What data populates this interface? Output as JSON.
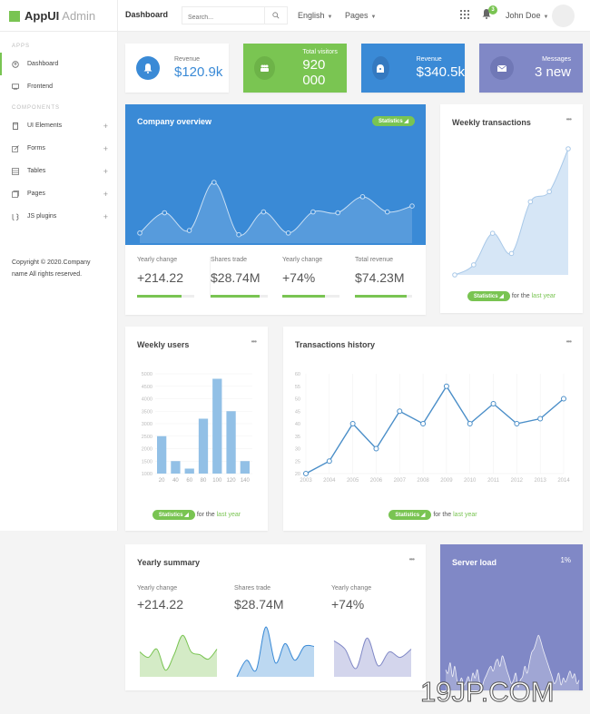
{
  "brand": {
    "name_bold": "AppUI",
    "name_light": "Admin"
  },
  "topbar": {
    "title": "Dashboard",
    "search_placeholder": "Search...",
    "language": "English",
    "pages": "Pages",
    "notifications_count": "3",
    "user_name": "John Doe"
  },
  "sidebar": {
    "section_apps": "APPS",
    "section_components": "COMPONENTS",
    "apps": [
      {
        "label": "Dashboard",
        "icon": "dashboard-icon",
        "active": true
      },
      {
        "label": "Frontend",
        "icon": "monitor-icon"
      }
    ],
    "components": [
      {
        "label": "UI Elements",
        "icon": "mobile-icon"
      },
      {
        "label": "Forms",
        "icon": "edit-icon"
      },
      {
        "label": "Tables",
        "icon": "table-icon"
      },
      {
        "label": "Pages",
        "icon": "copy-icon"
      },
      {
        "label": "JS plugins",
        "icon": "plugin-icon"
      }
    ],
    "copyright_line1": "Copyright © 2020.Company",
    "copyright_line2": "name All rights reserved."
  },
  "stats": [
    {
      "label": "Revenue",
      "value": "$120.9k",
      "icon": "bell-icon",
      "bg": "#ffffff",
      "accent": "#3a8ad6"
    },
    {
      "label": "Total visitors",
      "value": "920 000",
      "icon": "users-icon",
      "bg": "#7ac552",
      "accent": "#6db348"
    },
    {
      "label": "Revenue",
      "value": "$340.5k",
      "icon": "piggy-bank-icon",
      "bg": "#3a8ad6",
      "accent": "#3479c0"
    },
    {
      "label": "Messages",
      "value": "3 new",
      "icon": "envelope-icon",
      "bg": "#8088c6",
      "accent": "#7078b6"
    }
  ],
  "company_overview": {
    "title": "Company overview",
    "badge": "Statistics",
    "kpis": [
      {
        "label": "Yearly change",
        "value": "+214.22",
        "progress": 0.78
      },
      {
        "label": "Shares trade",
        "value": "$28.74M",
        "progress": 0.85
      },
      {
        "label": "Yearly change",
        "value": "+74%",
        "progress": 0.75
      },
      {
        "label": "Total revenue",
        "value": "$74.23M",
        "progress": 0.9
      }
    ]
  },
  "weekly_transactions": {
    "title": "Weekly transactions",
    "badge": "Statistics",
    "footer_text": "for the",
    "footer_link": "last year"
  },
  "weekly_users": {
    "title": "Weekly users",
    "badge": "Statistics",
    "footer_text": "for the",
    "footer_link": "last year"
  },
  "transactions_history": {
    "title": "Transactions history",
    "badge": "Statistics",
    "footer_text": "for the",
    "footer_link": "last year"
  },
  "yearly_summary": {
    "title": "Yearly summary",
    "items": [
      {
        "label": "Yearly change",
        "value": "+214.22",
        "color": "#79c452",
        "fill": "#d4ebc6"
      },
      {
        "label": "Shares trade",
        "value": "$28.74M",
        "color": "#3a8ad6",
        "fill": "#bcd8f1"
      },
      {
        "label": "Yearly change",
        "value": "+74%",
        "color": "#8088c6",
        "fill": "#d3d5ec"
      }
    ]
  },
  "server_load": {
    "title": "Server load",
    "value": "1%"
  },
  "watermark": "19JP.COM",
  "chart_data": [
    {
      "id": "company_overview",
      "type": "area",
      "title": "Company overview",
      "x": [
        1,
        2,
        3,
        4,
        5,
        6,
        7,
        8,
        9,
        10,
        11,
        12
      ],
      "values": [
        12,
        36,
        15,
        72,
        10,
        37,
        12,
        37,
        36,
        55,
        37,
        44
      ],
      "ylim": [
        0,
        100
      ]
    },
    {
      "id": "weekly_transactions",
      "type": "area",
      "title": "Weekly transactions",
      "x": [
        1,
        2,
        3,
        4,
        5,
        6,
        7
      ],
      "values": [
        0,
        8,
        33,
        17,
        58,
        66,
        100
      ],
      "ylim": [
        0,
        100
      ]
    },
    {
      "id": "weekly_users",
      "type": "bar",
      "title": "Weekly users",
      "categories": [
        "20",
        "40",
        "60",
        "80",
        "100",
        "120",
        "140"
      ],
      "values": [
        2500,
        1500,
        1200,
        3200,
        4800,
        3500,
        1500
      ],
      "yticks": [
        1000,
        1500,
        2000,
        2500,
        3000,
        3500,
        4000,
        4500,
        5000
      ],
      "ylim": [
        1000,
        5000
      ],
      "grid": true
    },
    {
      "id": "transactions_history",
      "type": "line",
      "title": "Transactions history",
      "categories": [
        "2003",
        "2004",
        "2005",
        "2006",
        "2007",
        "2008",
        "2009",
        "2010",
        "2011",
        "2012",
        "2013",
        "2014"
      ],
      "values": [
        20,
        25,
        40,
        30,
        45,
        40,
        55,
        40,
        48,
        40,
        42,
        50
      ],
      "yticks": [
        20,
        25,
        30,
        35,
        40,
        45,
        50,
        55,
        60
      ],
      "ylim": [
        20,
        60
      ],
      "grid": true
    },
    {
      "id": "yearly_summary_1",
      "type": "area",
      "values": [
        45,
        35,
        50,
        12,
        40,
        75,
        45,
        40,
        32,
        50
      ],
      "ylim": [
        0,
        100
      ]
    },
    {
      "id": "yearly_summary_2",
      "type": "area",
      "values": [
        0,
        30,
        12,
        90,
        25,
        60,
        30,
        55,
        55
      ],
      "ylim": [
        0,
        100
      ]
    },
    {
      "id": "yearly_summary_3",
      "type": "area",
      "values": [
        65,
        50,
        15,
        70,
        20,
        45,
        35,
        50
      ],
      "ylim": [
        0,
        100
      ]
    },
    {
      "id": "server_load",
      "type": "area",
      "title": "Server load",
      "values": [
        30,
        25,
        40,
        20,
        35,
        15,
        10,
        18,
        8,
        12,
        20,
        10,
        25,
        18,
        30,
        12,
        5,
        15,
        22,
        30,
        35,
        28,
        40,
        45,
        35,
        50,
        42,
        30,
        20,
        10,
        15,
        25,
        5,
        15,
        20,
        35,
        25,
        40,
        55,
        60,
        70,
        80,
        72,
        60,
        50,
        40,
        30,
        20,
        10,
        15,
        25,
        8,
        18,
        12,
        20,
        28,
        18,
        24,
        10,
        15
      ],
      "ylim": [
        0,
        100
      ]
    }
  ]
}
